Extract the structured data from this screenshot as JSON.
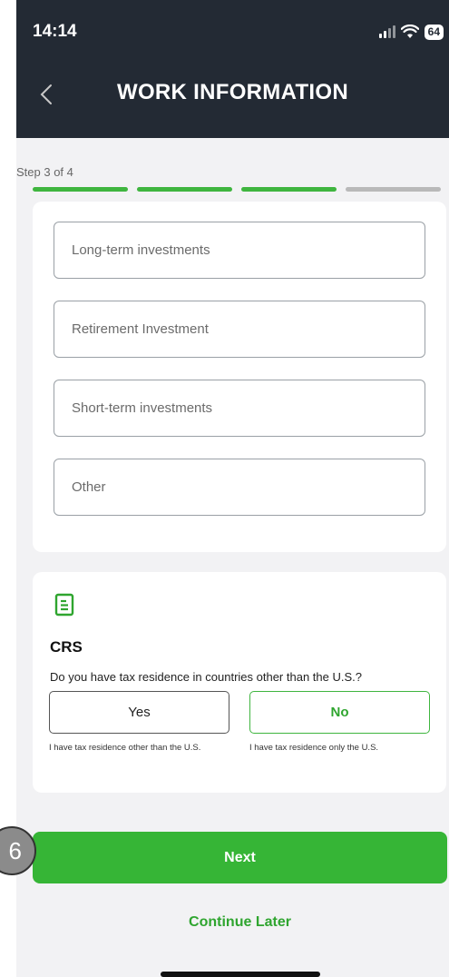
{
  "status_bar": {
    "time": "14:14",
    "battery": "64"
  },
  "header": {
    "title": "WORK INFORMATION"
  },
  "progress": {
    "label": "Step 3 of 4",
    "current": 3,
    "total": 4
  },
  "investment_options": [
    "Long-term investments",
    "Retirement Investment",
    "Short-term investments",
    "Other"
  ],
  "crs": {
    "title": "CRS",
    "question": "Do you have tax residence in countries other than the U.S.?",
    "yes_label": "Yes",
    "no_label": "No",
    "yes_hint": "I have tax residence other than the U.S.",
    "no_hint": "I have tax residence only the U.S.",
    "selected": "No"
  },
  "actions": {
    "next_label": "Next",
    "continue_later_label": "Continue Later"
  },
  "annotation": {
    "step_number": "6"
  },
  "colors": {
    "accent_green": "#36b536",
    "header_bg": "#232a34"
  }
}
